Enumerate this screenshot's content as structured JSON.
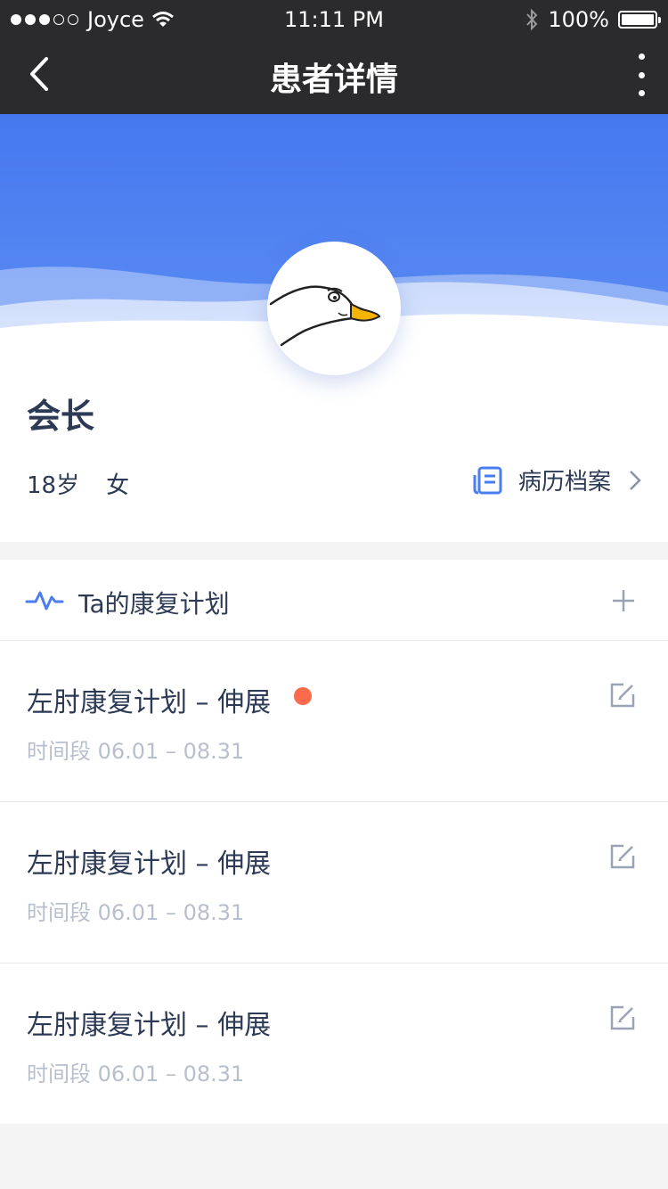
{
  "status_bar": {
    "carrier": "Joyce",
    "time": "11:11 PM",
    "battery": "100%"
  },
  "nav": {
    "title": "患者详情"
  },
  "patient": {
    "name": "会长",
    "age": "18岁",
    "gender": "女",
    "records_label": "病历档案"
  },
  "plan": {
    "header": "Ta的康复计划",
    "items": [
      {
        "title": "左肘康复计划 – 伸展",
        "period": "时间段 06.01 – 08.31",
        "unread": true
      },
      {
        "title": "左肘康复计划 – 伸展",
        "period": "时间段 06.01 – 08.31",
        "unread": false
      },
      {
        "title": "左肘康复计划 – 伸展",
        "period": "时间段 06.01 – 08.31",
        "unread": false
      }
    ]
  },
  "colors": {
    "accent": "#4a7df0",
    "unread_dot": "#fa6a4c",
    "nav_bg": "#2b2b2d"
  }
}
